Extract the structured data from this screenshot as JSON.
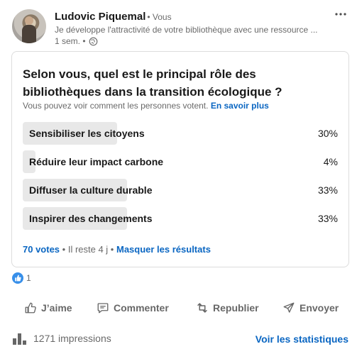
{
  "author": {
    "name": "Ludovic Piquemal",
    "degree": "• Vous",
    "headline": "Je développe l'attractivité de votre bibliothèque avec une ressource ...",
    "time": "1 sem. •",
    "visibility_icon": "globe-icon"
  },
  "poll": {
    "question": "Selon vous, quel est le principal rôle des bibliothèques dans la transition écologique ?",
    "note": "Vous pouvez voir comment les personnes votent.",
    "learn_more": "En savoir plus",
    "options": [
      {
        "label": "Sensibiliser les citoyens",
        "percent": 30,
        "percent_text": "30%"
      },
      {
        "label": "Réduire leur impact carbone",
        "percent": 4,
        "percent_text": "4%"
      },
      {
        "label": "Diffuser la culture durable",
        "percent": 33,
        "percent_text": "33%"
      },
      {
        "label": "Inspirer des changements",
        "percent": 33,
        "percent_text": "33%"
      }
    ],
    "votes": "70 votes",
    "remaining": "• Il reste 4 j •",
    "hide_results": "Masquer les résultats"
  },
  "reactions": {
    "count": "1",
    "icon": "like-reaction-icon"
  },
  "actions": {
    "like": "J’aime",
    "comment": "Commenter",
    "repost": "Republier",
    "send": "Envoyer"
  },
  "footer": {
    "impressions": "1271 impressions",
    "stats_link": "Voir les statistiques"
  },
  "colors": {
    "accent": "#0a66c2",
    "bar": "#e8e8e8",
    "like_badge": "#378fe9"
  }
}
